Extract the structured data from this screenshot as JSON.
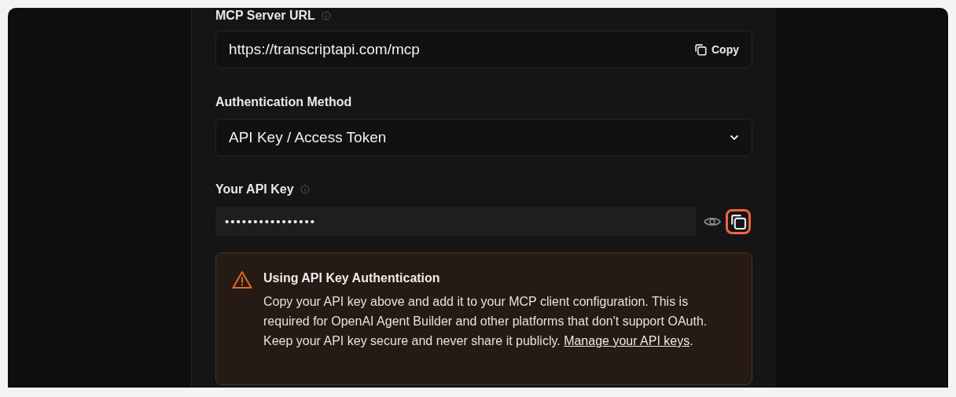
{
  "server_url": {
    "label": "MCP Server URL",
    "value": "https://transcriptapi.com/mcp",
    "copy_button": "Copy"
  },
  "auth_method": {
    "label": "Authentication Method",
    "value": "API Key / Access Token"
  },
  "api_key": {
    "label": "Your API Key",
    "value": "••••••••••••••••",
    "copy_highlighted": true
  },
  "alert": {
    "title": "Using API Key Authentication",
    "body": "Copy your API key above and add it to your MCP client configuration. This is required for OpenAI Agent Builder and other platforms that don't support OAuth. Keep your API key secure and never share it publicly. ",
    "link": "Manage your API keys",
    "after_link": "."
  }
}
